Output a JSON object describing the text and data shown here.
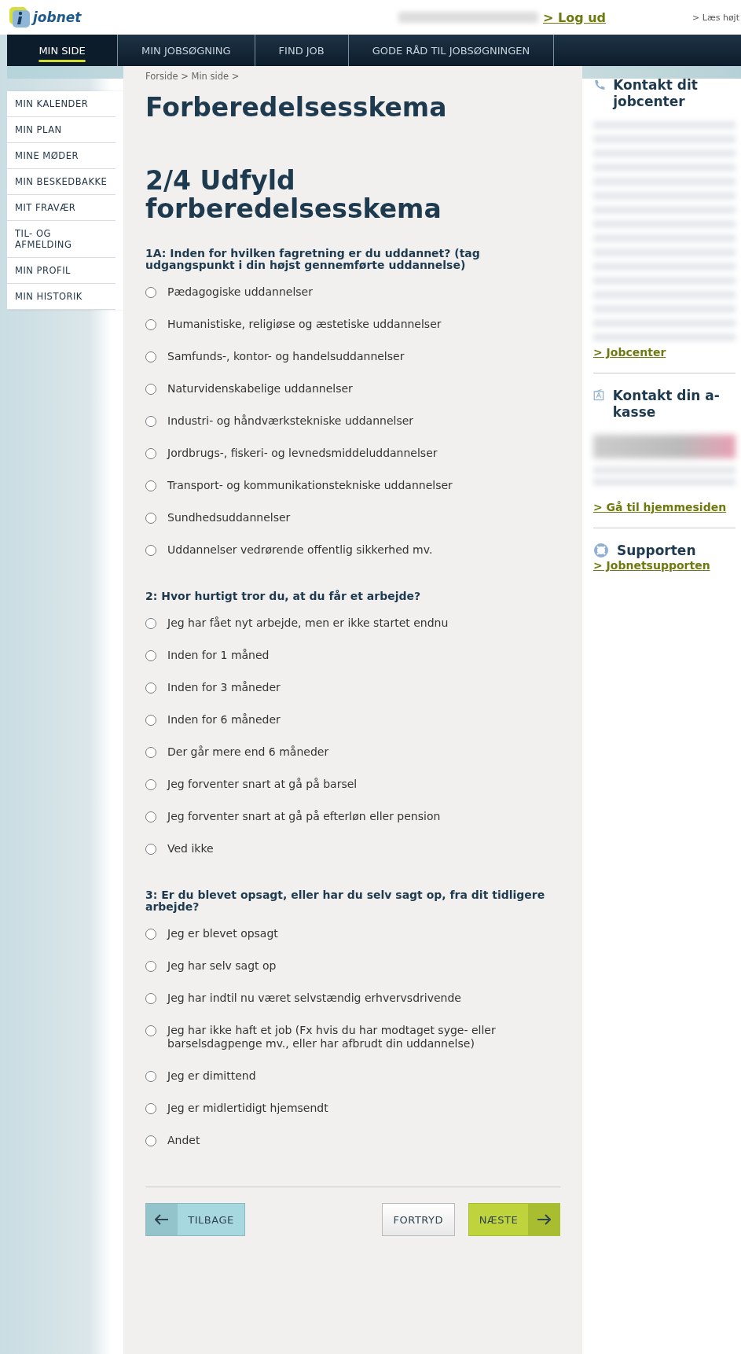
{
  "header": {
    "logo_text": "jobnet",
    "logout_link": "> Log ud",
    "read_aloud_link": "> Læs højt"
  },
  "nav_tabs": [
    {
      "label": "MIN SIDE",
      "selected": true
    },
    {
      "label": "MIN JOBSØGNING",
      "selected": false
    },
    {
      "label": "FIND JOB",
      "selected": false
    },
    {
      "label": "GODE RÅD TIL JOBSØGNINGEN",
      "selected": false
    }
  ],
  "sidebar": {
    "items": [
      "MIN KALENDER",
      "MIN PLAN",
      "MINE MØDER",
      "MIN BESKEDBAKKE",
      "MIT FRAVÆR",
      "TIL- OG AFMELDING",
      "MIN PROFIL",
      "MIN HISTORIK"
    ]
  },
  "breadcrumb": "Forside > Min side >",
  "title": "Forberedelsesskema",
  "step_title": "2/4 Udfyld forberedelsesskema",
  "questions": [
    {
      "label": "1A: Inden for hvilken fagretning er du uddannet? (tag udgangspunkt i din højst gennemførte uddannelse)",
      "options": [
        {
          "label": "Pædagogiske uddannelser",
          "selected": false
        },
        {
          "label": "Humanistiske, religiøse og æstetiske uddannelser",
          "selected": false
        },
        {
          "label": "Samfunds-, kontor- og handelsuddannelser",
          "selected": false
        },
        {
          "label": "Naturvidenskabelige uddannelser",
          "selected": false
        },
        {
          "label": "Industri- og håndværkstekniske uddannelser",
          "selected": false
        },
        {
          "label": "Jordbrugs-, fiskeri- og levnedsmiddeluddannelser",
          "selected": false
        },
        {
          "label": "Transport- og kommunikationstekniske uddannelser",
          "selected": false
        },
        {
          "label": "Sundhedsuddannelser",
          "selected": false
        },
        {
          "label": "Uddannelser vedrørende offentlig sikkerhed mv.",
          "selected": false
        }
      ]
    },
    {
      "label": "2: Hvor hurtigt tror du, at du får et arbejde?",
      "options": [
        {
          "label": "Jeg har fået nyt arbejde, men er ikke startet endnu",
          "selected": false
        },
        {
          "label": "Inden for 1 måned",
          "selected": false
        },
        {
          "label": "Inden for 3 måneder",
          "selected": false
        },
        {
          "label": "Inden for 6 måneder",
          "selected": false
        },
        {
          "label": "Der går mere end 6 måneder",
          "selected": false
        },
        {
          "label": "Jeg forventer snart at gå på barsel",
          "selected": false
        },
        {
          "label": "Jeg forventer snart at gå på efterløn eller pension",
          "selected": false
        },
        {
          "label": "Ved ikke",
          "selected": false
        }
      ]
    },
    {
      "label": "3: Er du blevet opsagt, eller har du selv sagt op, fra dit tidligere arbejde?",
      "options": [
        {
          "label": "Jeg er blevet opsagt",
          "selected": false
        },
        {
          "label": "Jeg har selv sagt op",
          "selected": false
        },
        {
          "label": "Jeg har indtil nu været selvstændig erhvervsdrivende",
          "selected": false
        },
        {
          "label": "Jeg har ikke haft et job (Fx hvis du har modtaget syge- eller barselsdagpenge mv., eller har afbrudt din uddannelse)",
          "selected": false
        },
        {
          "label": "Jeg er dimittend",
          "selected": false
        },
        {
          "label": "Jeg er midlertidigt hjemsendt",
          "selected": false
        },
        {
          "label": "Andet",
          "selected": false
        }
      ]
    }
  ],
  "buttons": {
    "back": "TILBAGE",
    "cancel": "FORTRYD",
    "next": "NÆSTE"
  },
  "right_panel": [
    {
      "kind": "jobcenter",
      "title": "Kontakt dit jobcenter",
      "link": "> Jobcenter"
    },
    {
      "kind": "akasse",
      "title": "Kontakt din a-kasse",
      "link": "> Gå til hjemmesiden"
    },
    {
      "kind": "support",
      "title": "Supporten",
      "link": "> Jobnetsupporten"
    }
  ]
}
